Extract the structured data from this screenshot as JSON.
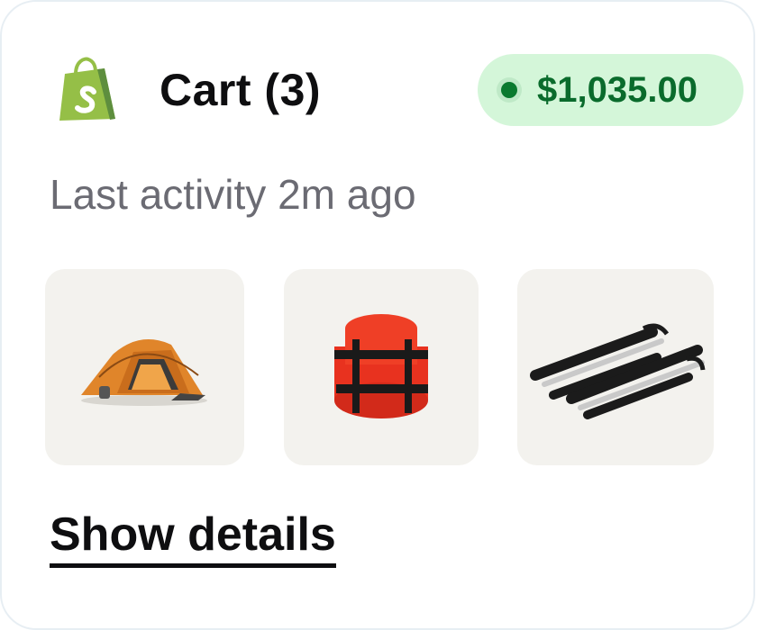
{
  "header": {
    "logo_icon": "shopify-bag-icon",
    "title": "Cart (3)",
    "total": "$1,035.00",
    "total_color": "#0a6b2c",
    "badge_bg": "#d4f6d9"
  },
  "activity": "Last activity 2m ago",
  "items": [
    {
      "icon": "tent-icon",
      "name": "Tent"
    },
    {
      "icon": "sleeping-bag-icon",
      "name": "Sleeping bag"
    },
    {
      "icon": "trekking-poles-icon",
      "name": "Trekking poles"
    }
  ],
  "link": {
    "label": "Show details"
  }
}
